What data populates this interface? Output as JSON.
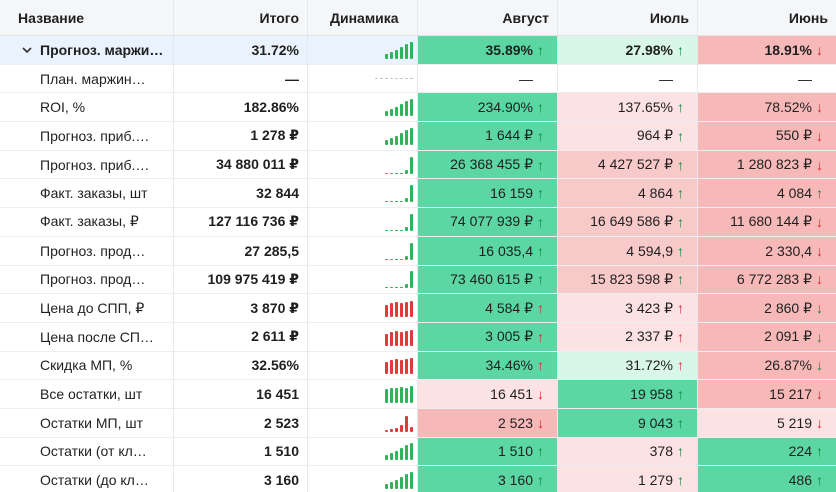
{
  "columns": {
    "name": "Название",
    "total": "Итого",
    "dynamics": "Динамика",
    "m1": "Август",
    "m2": "Июль",
    "m3": "Июнь"
  },
  "rows": [
    {
      "name": "Прогноз. маржи…",
      "total": "31.72%",
      "spark": "green-rising",
      "m1": "35.89%",
      "m1_arrow": "↑",
      "m1_dir": "up",
      "m1_bg": "g-strong",
      "m2": "27.98%",
      "m2_arrow": "↑",
      "m2_dir": "up",
      "m2_bg": "g-light",
      "m3": "18.91%",
      "m3_arrow": "↓",
      "m3_dir": "down",
      "m3_bg": "r-strong"
    },
    {
      "name": "План. маржин…",
      "total": "—",
      "spark": "dashed",
      "m1": "—",
      "m1_arrow": "",
      "m1_dir": "",
      "m1_bg": "none",
      "m2": "—",
      "m2_arrow": "",
      "m2_dir": "",
      "m2_bg": "none",
      "m3": "—",
      "m3_arrow": "",
      "m3_dir": "",
      "m3_bg": "none"
    },
    {
      "name": "ROI, %",
      "total": "182.86%",
      "spark": "green-rising",
      "m1": "234.90%",
      "m1_arrow": "↑",
      "m1_dir": "up",
      "m1_bg": "g-strong",
      "m2": "137.65%",
      "m2_arrow": "↑",
      "m2_dir": "up",
      "m2_bg": "r-light",
      "m3": "78.52%",
      "m3_arrow": "↓",
      "m3_dir": "down",
      "m3_bg": "r-strong"
    },
    {
      "name": "Прогноз. приб.…",
      "total": "1 278 ₽",
      "spark": "green-rising",
      "m1": "1 644 ₽",
      "m1_arrow": "↑",
      "m1_dir": "up",
      "m1_bg": "g-strong",
      "m2": "964 ₽",
      "m2_arrow": "↑",
      "m2_dir": "up",
      "m2_bg": "r-light",
      "m3": "550 ₽",
      "m3_arrow": "↓",
      "m3_dir": "down",
      "m3_bg": "r-strong"
    },
    {
      "name": "Прогноз. приб.…",
      "total": "34 880 011 ₽",
      "spark": "green-flat",
      "m1": "26 368 455 ₽",
      "m1_arrow": "↑",
      "m1_dir": "up",
      "m1_bg": "g-strong",
      "m2": "4 427 527 ₽",
      "m2_arrow": "↑",
      "m2_dir": "up",
      "m2_bg": "r-mid",
      "m3": "1 280 823 ₽",
      "m3_arrow": "↓",
      "m3_dir": "down",
      "m3_bg": "r-strong"
    },
    {
      "name": "Факт. заказы, шт",
      "total": "32 844",
      "spark": "green-flat",
      "m1": "16 159",
      "m1_arrow": "↑",
      "m1_dir": "up",
      "m1_bg": "g-strong",
      "m2": "4 864",
      "m2_arrow": "↑",
      "m2_dir": "up",
      "m2_bg": "r-mid",
      "m3": "4 084",
      "m3_arrow": "↑",
      "m3_dir": "up",
      "m3_bg": "r-strong"
    },
    {
      "name": "Факт. заказы, ₽",
      "total": "127 116 736 ₽",
      "spark": "green-flat",
      "m1": "74 077 939 ₽",
      "m1_arrow": "↑",
      "m1_dir": "up",
      "m1_bg": "g-strong",
      "m2": "16 649 586 ₽",
      "m2_arrow": "↑",
      "m2_dir": "up",
      "m2_bg": "r-mid",
      "m3": "11 680 144 ₽",
      "m3_arrow": "↓",
      "m3_dir": "down",
      "m3_bg": "r-strong"
    },
    {
      "name": "Прогноз. прод…",
      "total": "27 285,5",
      "spark": "green-flat",
      "m1": "16 035,4",
      "m1_arrow": "↑",
      "m1_dir": "up",
      "m1_bg": "g-strong",
      "m2": "4 594,9",
      "m2_arrow": "↑",
      "m2_dir": "up",
      "m2_bg": "r-mid",
      "m3": "2 330,4",
      "m3_arrow": "↓",
      "m3_dir": "down",
      "m3_bg": "r-strong"
    },
    {
      "name": "Прогноз. прод…",
      "total": "109 975 419 ₽",
      "spark": "green-flat",
      "m1": "73 460 615 ₽",
      "m1_arrow": "↑",
      "m1_dir": "up",
      "m1_bg": "g-strong",
      "m2": "15 823 598 ₽",
      "m2_arrow": "↑",
      "m2_dir": "up",
      "m2_bg": "r-mid",
      "m3": "6 772 283 ₽",
      "m3_arrow": "↓",
      "m3_dir": "down",
      "m3_bg": "r-strong"
    },
    {
      "name": "Цена до СПП, ₽",
      "total": "3 870 ₽",
      "spark": "red-high",
      "m1": "4 584 ₽",
      "m1_arrow": "↑",
      "m1_dir": "down",
      "m1_bg": "g-strong",
      "m2": "3 423 ₽",
      "m2_arrow": "↑",
      "m2_dir": "down",
      "m2_bg": "r-light",
      "m3": "2 860 ₽",
      "m3_arrow": "↓",
      "m3_dir": "up",
      "m3_bg": "r-strong"
    },
    {
      "name": "Цена после СП…",
      "total": "2 611 ₽",
      "spark": "red-high",
      "m1": "3 005 ₽",
      "m1_arrow": "↑",
      "m1_dir": "down",
      "m1_bg": "g-strong",
      "m2": "2 337 ₽",
      "m2_arrow": "↑",
      "m2_dir": "down",
      "m2_bg": "r-light",
      "m3": "2 091 ₽",
      "m3_arrow": "↓",
      "m3_dir": "up",
      "m3_bg": "r-strong"
    },
    {
      "name": "Скидка МП, %",
      "total": "32.56%",
      "spark": "red-high",
      "m1": "34.46%",
      "m1_arrow": "↑",
      "m1_dir": "down",
      "m1_bg": "g-strong",
      "m2": "31.72%",
      "m2_arrow": "↑",
      "m2_dir": "down",
      "m2_bg": "g-light",
      "m3": "26.87%",
      "m3_arrow": "↓",
      "m3_dir": "up",
      "m3_bg": "r-strong"
    },
    {
      "name": "Все остатки, шт",
      "total": "16 451",
      "spark": "green-high",
      "m1": "16 451",
      "m1_arrow": "↓",
      "m1_dir": "down",
      "m1_bg": "r-light",
      "m2": "19 958",
      "m2_arrow": "↑",
      "m2_dir": "up",
      "m2_bg": "g-strong",
      "m3": "15 217",
      "m3_arrow": "↓",
      "m3_dir": "down",
      "m3_bg": "r-strong"
    },
    {
      "name": "Остатки МП, шт",
      "total": "2 523",
      "spark": "red-low",
      "m1": "2 523",
      "m1_arrow": "↓",
      "m1_dir": "down",
      "m1_bg": "r-strong",
      "m2": "9 043",
      "m2_arrow": "↑",
      "m2_dir": "up",
      "m2_bg": "g-strong",
      "m3": "5 219",
      "m3_arrow": "↓",
      "m3_dir": "down",
      "m3_bg": "r-light"
    },
    {
      "name": "Остатки (от кл…",
      "total": "1 510",
      "spark": "green-rising",
      "m1": "1 510",
      "m1_arrow": "↑",
      "m1_dir": "up",
      "m1_bg": "g-strong",
      "m2": "378",
      "m2_arrow": "↑",
      "m2_dir": "up",
      "m2_bg": "r-light",
      "m3": "224",
      "m3_arrow": "↑",
      "m3_dir": "up",
      "m3_bg": "g-strong"
    },
    {
      "name": "Остатки (до кл…",
      "total": "3 160",
      "spark": "green-rising",
      "m1": "3 160",
      "m1_arrow": "↑",
      "m1_dir": "up",
      "m1_bg": "g-strong",
      "m2": "1 279",
      "m2_arrow": "↑",
      "m2_dir": "up",
      "m2_bg": "r-light",
      "m3": "486",
      "m3_arrow": "↑",
      "m3_dir": "up",
      "m3_bg": "g-strong"
    }
  ],
  "colors": {
    "spark_green": "#2fb45a",
    "spark_red": "#e03a3a",
    "arrow_up": "#0f8a3d",
    "arrow_down": "#d9262c"
  }
}
